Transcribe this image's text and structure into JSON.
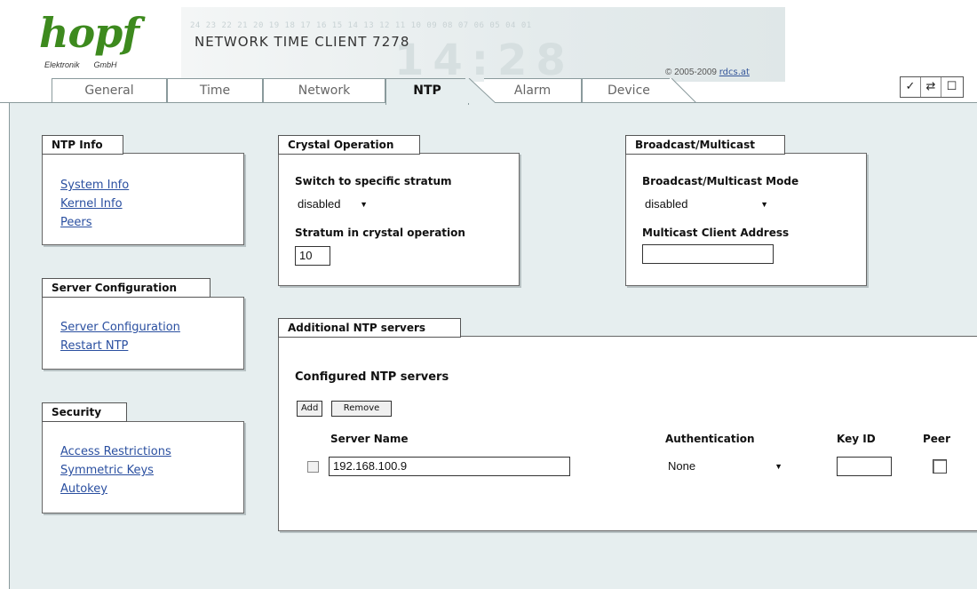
{
  "header": {
    "logo_text": "hopf",
    "logo_sub_left": "Elektronik",
    "logo_sub_right": "GmbH",
    "product_title": "NETWORK TIME CLIENT 7278",
    "copyright_prefix": "© 2005-2009 ",
    "copyright_link": "rdcs.at",
    "ghost_digits": "24 23 22 21 20 19 18 17 16 15 14 13 12 11 10 09 08 07 06 05 04 01",
    "ghost_big": "14:28"
  },
  "tabs": [
    {
      "label": "General"
    },
    {
      "label": "Time"
    },
    {
      "label": "Network"
    },
    {
      "label": "NTP"
    },
    {
      "label": "Alarm"
    },
    {
      "label": "Device"
    }
  ],
  "active_tab": "NTP",
  "action_icons": [
    {
      "name": "apply-icon",
      "glyph": "✓"
    },
    {
      "name": "refresh-icon",
      "glyph": "⇄"
    },
    {
      "name": "save-icon",
      "glyph": "☐"
    }
  ],
  "ntp_info": {
    "title": "NTP Info",
    "links": [
      "System Info",
      "Kernel Info",
      "Peers"
    ]
  },
  "server_config": {
    "title": "Server Configuration",
    "links": [
      "Server Configuration",
      "Restart NTP"
    ]
  },
  "security": {
    "title": "Security",
    "links": [
      "Access Restrictions",
      "Symmetric Keys",
      "Autokey"
    ]
  },
  "crystal": {
    "title": "Crystal Operation",
    "switch_label": "Switch to specific stratum",
    "switch_value": "disabled",
    "stratum_label": "Stratum in crystal operation",
    "stratum_value": "10"
  },
  "broadcast": {
    "title": "Broadcast/Multicast",
    "mode_label": "Broadcast/Multicast Mode",
    "mode_value": "disabled",
    "address_label": "Multicast Client Address",
    "address_value": ""
  },
  "additional": {
    "title": "Additional NTP servers",
    "subtitle": "Configured NTP servers",
    "add_label": "Add",
    "remove_label": "Remove",
    "columns": {
      "server_name": "Server Name",
      "authentication": "Authentication",
      "key_id": "Key ID",
      "peer": "Peer"
    },
    "rows": [
      {
        "server": "192.168.100.9",
        "authentication": "None",
        "key_id": "",
        "peer": false
      }
    ]
  }
}
